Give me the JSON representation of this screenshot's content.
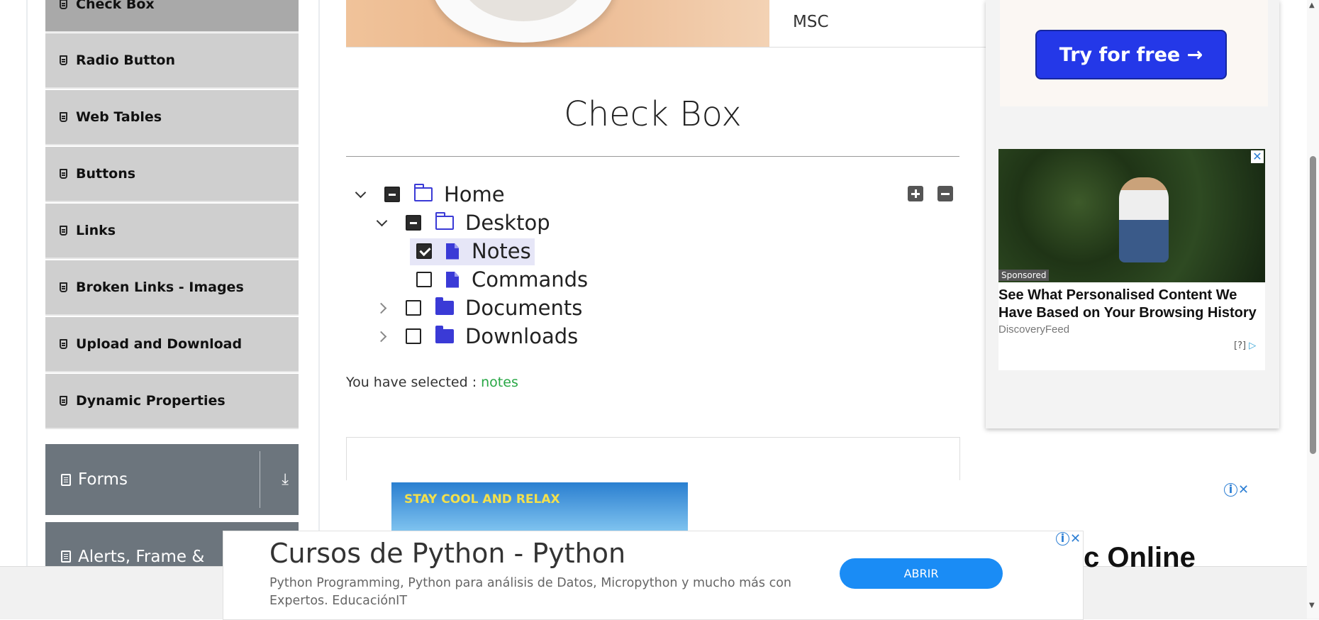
{
  "sidebar": {
    "items": [
      {
        "label": "Check Box",
        "active": true
      },
      {
        "label": "Radio Button"
      },
      {
        "label": "Web Tables"
      },
      {
        "label": "Buttons"
      },
      {
        "label": "Links"
      },
      {
        "label": "Broken Links - Images"
      },
      {
        "label": "Upload and Download"
      },
      {
        "label": "Dynamic Properties"
      }
    ],
    "groups": [
      {
        "label": "Forms"
      },
      {
        "label": "Alerts, Frame &"
      }
    ]
  },
  "banner": {
    "msc_text": "MSC"
  },
  "page": {
    "title": "Check Box"
  },
  "tree": {
    "home": "Home",
    "desktop": "Desktop",
    "notes": "Notes",
    "commands": "Commands",
    "documents": "Documents",
    "downloads": "Downloads"
  },
  "result": {
    "prefix": "You have selected :",
    "value": "notes"
  },
  "ads": {
    "inline_text": "STAY COOL AND RELAX",
    "try_button": "Try for free →",
    "sponsored_badge": "Sponsored",
    "sponsored_title": "See What Personalised Content We Have Based on Your Browsing History",
    "sponsored_source": "DiscoveryFeed",
    "sponsored_help": "[?]",
    "bottom_title": "Cursos de Python - Python",
    "bottom_desc": "Python Programming, Python para análisis de Datos, Micropython y mucho más con Expertos. EducaciónIT",
    "bottom_button": "ABRIR",
    "behind_text": "c Online"
  },
  "colors": {
    "accent": "#3a3ad6",
    "selected_green": "#28a745",
    "sidebar_group": "#6c757d",
    "ad_blue": "#1a8cf5"
  }
}
